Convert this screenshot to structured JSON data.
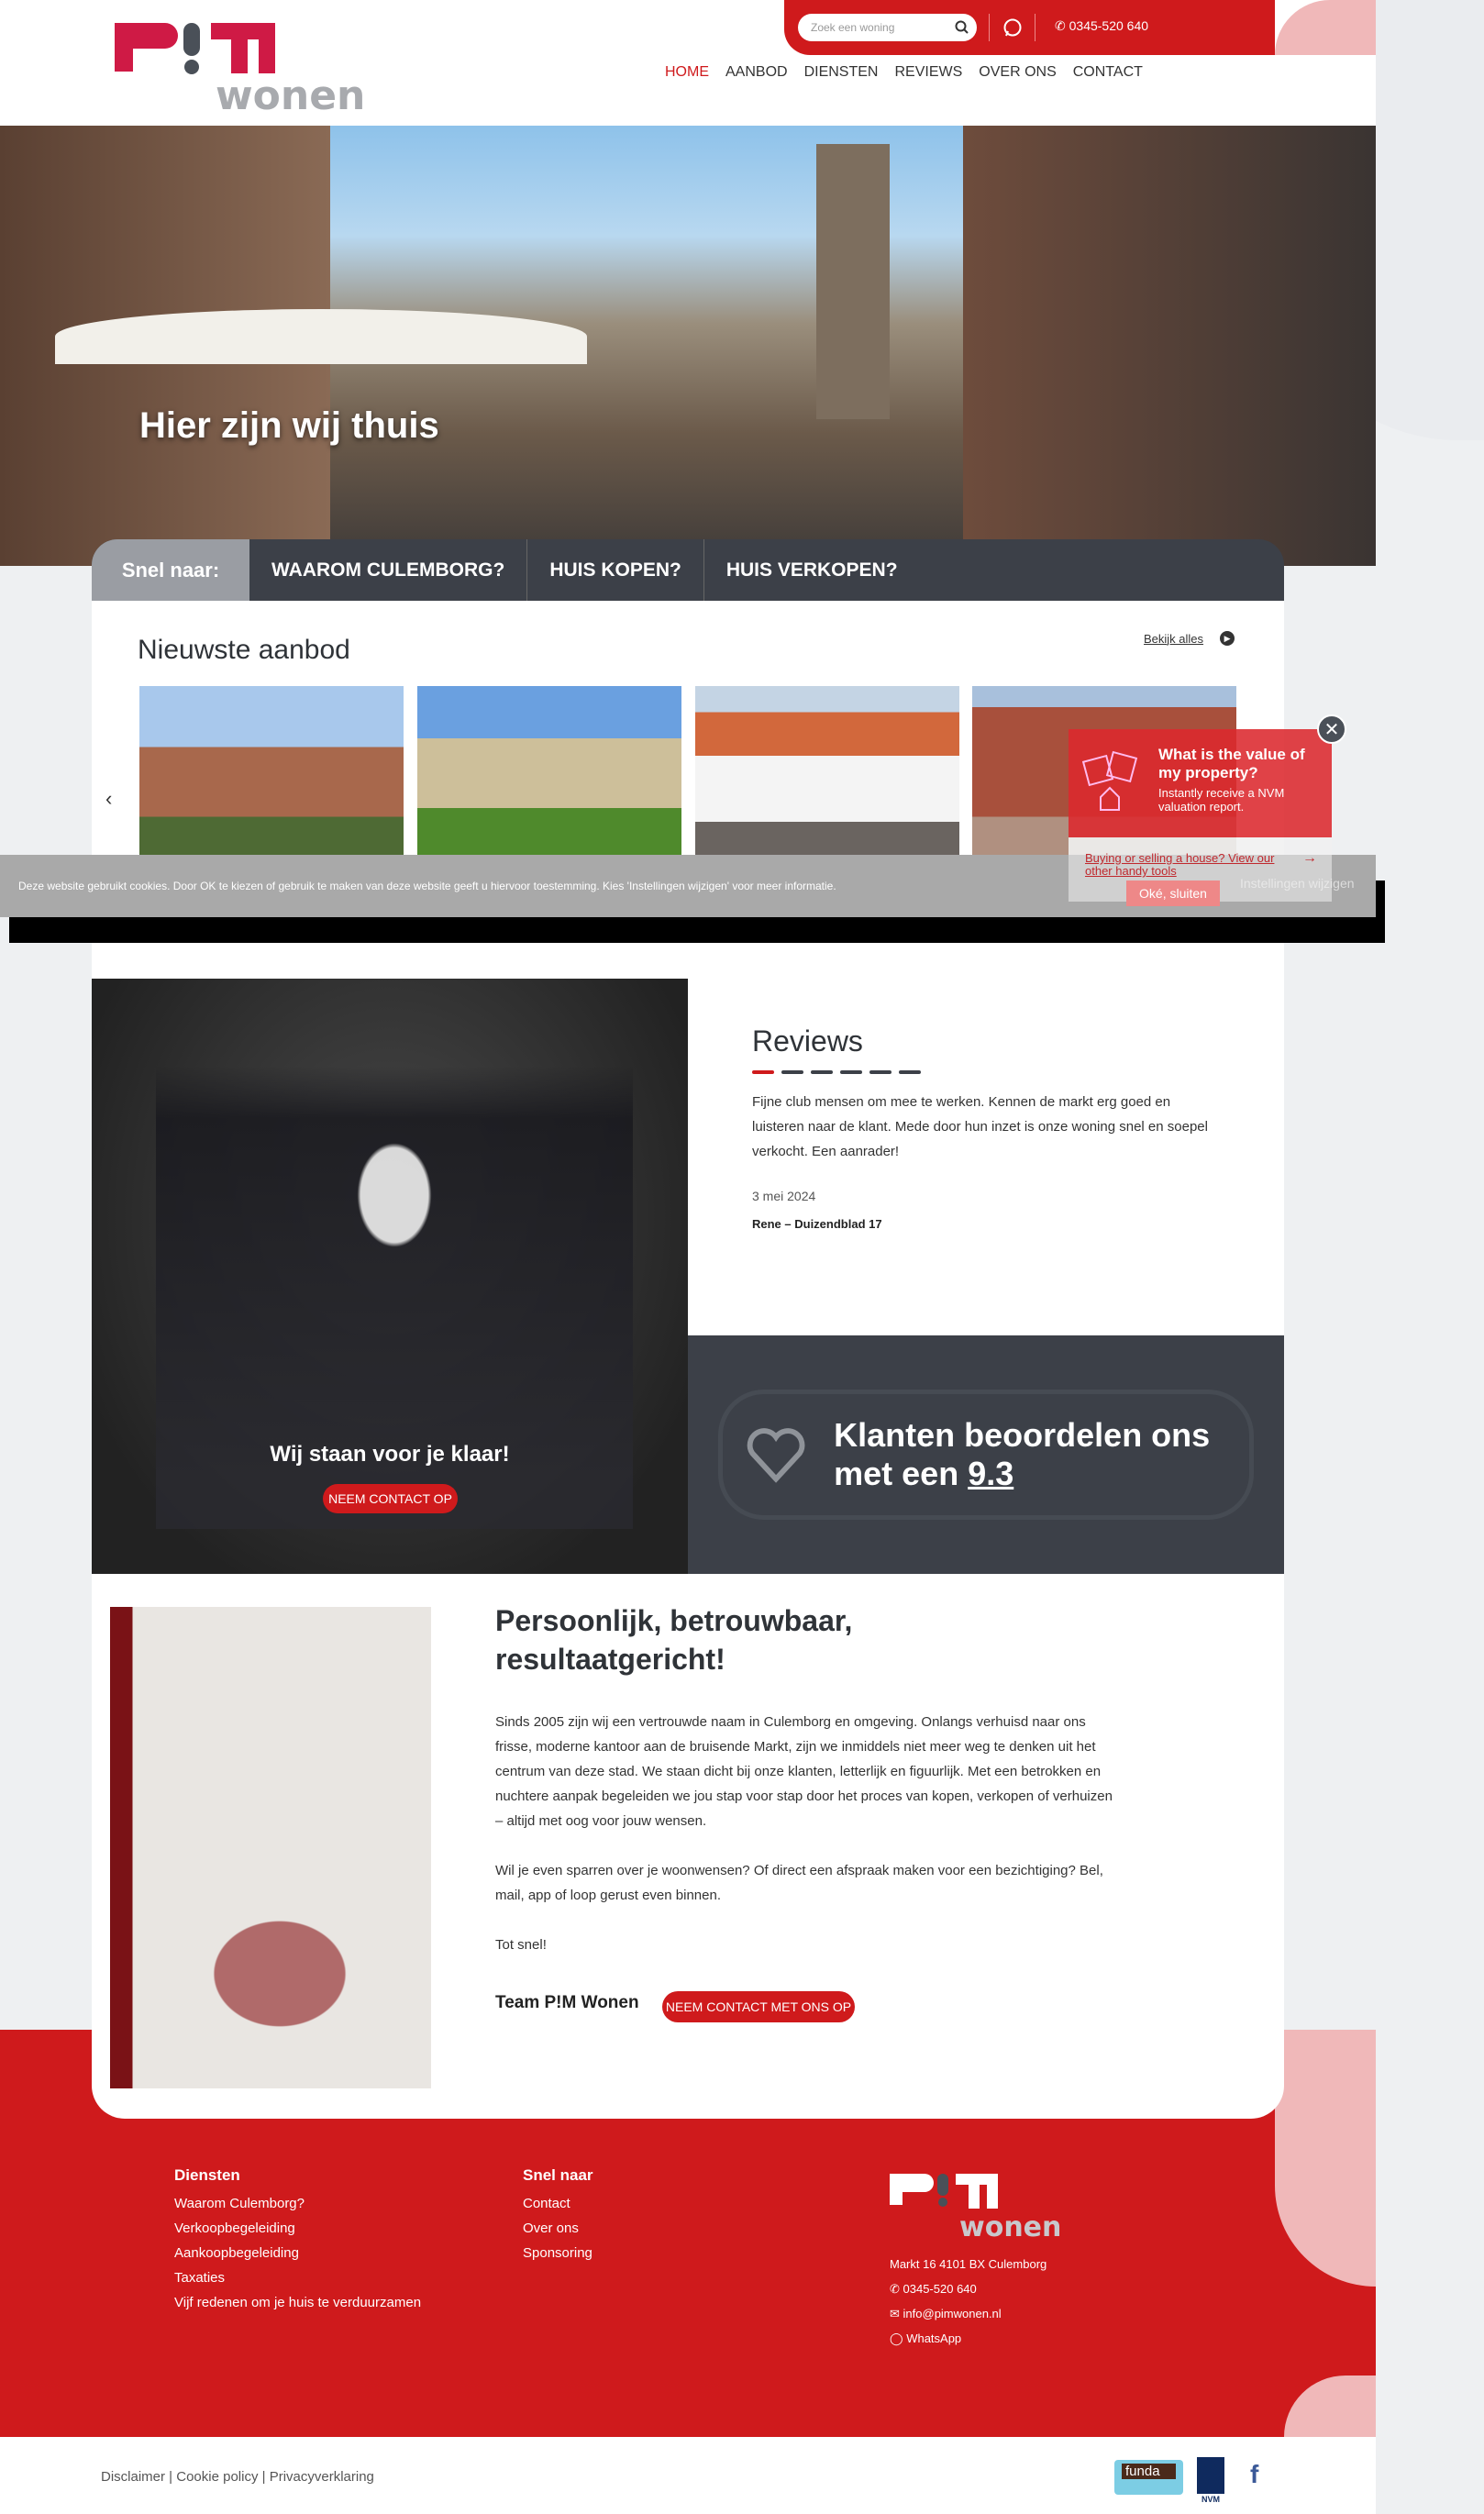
{
  "header": {
    "search_placeholder": "Zoek een woning",
    "phone": "0345-520 640",
    "nav": [
      "HOME",
      "AANBOD",
      "DIENSTEN",
      "REVIEWS",
      "OVER ONS",
      "CONTACT"
    ]
  },
  "hero": {
    "title": "Hier zijn wij thuis"
  },
  "quicklinks": {
    "label": "Snel naar:",
    "items": [
      "WAAROM CULEMBORG?",
      "HUIS KOPEN?",
      "HUIS VERKOPEN?"
    ]
  },
  "aanbod": {
    "title": "Nieuwste aanbod",
    "view_all": "Bekijk alles"
  },
  "cookie": {
    "text": "Deze website gebruikt cookies. Door OK te kiezen of gebruik te maken van deze website geeft u hiervoor toestemming. Kies 'Instellingen wijzigen' voor meer informatie.",
    "ok": "Oké, sluiten",
    "settings": "Instellingen wijzigen"
  },
  "popup": {
    "title": "What is the value of my property?",
    "subtitle": "Instantly receive a NVM valuation report.",
    "link": "Buying or selling a house? View our other handy tools"
  },
  "team": {
    "title": "Wij staan voor je klaar!",
    "button": "NEEM CONTACT OP"
  },
  "reviews": {
    "title": "Reviews",
    "text": "Fijne club mensen om mee te werken. Kennen de markt erg goed en luisteren naar de klant. Mede door hun inzet is onze woning snel en soepel verkocht. Een aanrader!",
    "date": "3 mei 2024",
    "author": "Rene – Duizendblad 17"
  },
  "rating": {
    "text": "Klanten beoordelen ons met een",
    "score": "9.3"
  },
  "about": {
    "title": "Persoonlijk, betrouwbaar, resultaatgericht!",
    "p1": "Sinds 2005 zijn wij een vertrouwde naam in Culemborg en omgeving. Onlangs verhuisd naar ons frisse, moderne kantoor aan de bruisende Markt, zijn we inmiddels niet meer weg te denken uit het centrum van deze stad. We staan dicht bij onze klanten, letterlijk en figuurlijk. Met een betrokken en nuchtere aanpak begeleiden we jou stap voor stap door het proces van kopen, verkopen of verhuizen – altijd met oog voor jouw wensen.",
    "p2": "Wil je even sparren over je woonwensen? Of direct een afspraak maken voor een bezichtiging? Bel, mail, app of loop gerust even binnen.",
    "p3": "Tot snel!",
    "signature": "Team P!M Wonen",
    "button": "NEEM CONTACT MET ONS OP"
  },
  "footer": {
    "diensten": {
      "title": "Diensten",
      "items": [
        "Waarom Culemborg?",
        "Verkoopbegeleiding",
        "Aankoopbegeleiding",
        "Taxaties",
        "Vijf redenen om je huis te verduurzamen"
      ]
    },
    "snel": {
      "title": "Snel naar",
      "items": [
        "Contact",
        "Over ons",
        "Sponsoring"
      ]
    },
    "address": "Markt 16 4101 BX Culemborg",
    "phone": "0345-520 640",
    "email": "info@pimwonen.nl",
    "whatsapp": "WhatsApp",
    "legal": [
      "Disclaimer",
      "Cookie policy",
      "Privacyverklaring"
    ],
    "logos": {
      "funda": "funda",
      "nvm": "NVM"
    }
  },
  "logo": {
    "text": "P!M wonen"
  },
  "colors": {
    "brand_red": "#cf1a1c",
    "dark": "#3c4048",
    "pink": "#f0b8b9"
  }
}
